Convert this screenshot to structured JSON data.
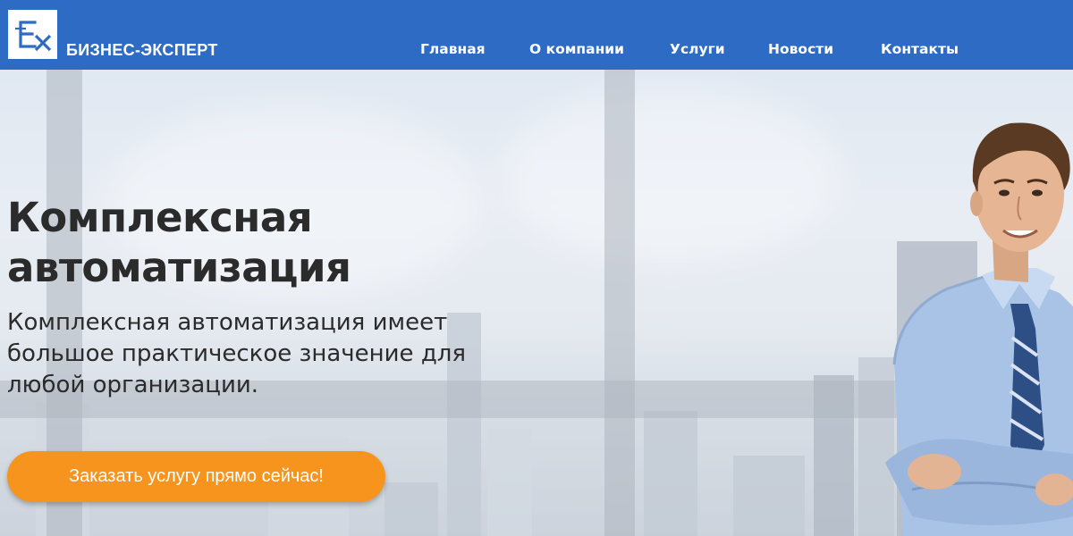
{
  "header": {
    "logo_letters": "Ex",
    "brand": "БИЗНЕС-ЭКСПЕРТ",
    "nav": [
      {
        "label": "Главная"
      },
      {
        "label": "О компании"
      },
      {
        "label": "Услуги"
      },
      {
        "label": "Новости"
      },
      {
        "label": "Контакты"
      }
    ]
  },
  "hero": {
    "title_line1": "Комплексная",
    "title_line2": "автоматизация",
    "subtitle": "Комплексная автоматизация имеет большое практическое значение для любой организации.",
    "cta_label": "Заказать услугу прямо сейчас!"
  },
  "colors": {
    "header_bg": "#2d6bc4",
    "cta_bg": "#f7941d",
    "text": "#2b2b2b"
  }
}
